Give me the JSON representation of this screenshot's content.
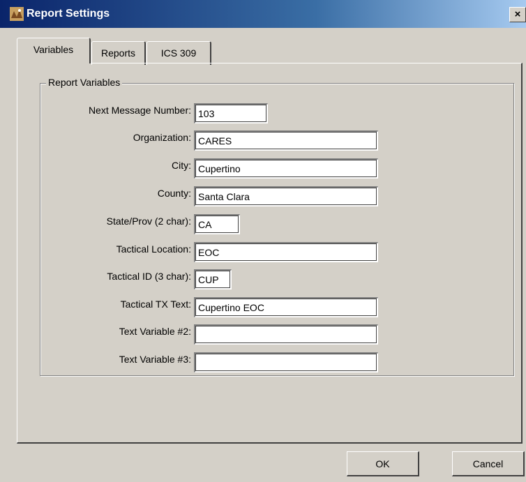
{
  "window": {
    "title": "Report Settings",
    "close_symbol": "×",
    "icon": "app-icon"
  },
  "tabs": [
    {
      "label": "Variables",
      "active": true
    },
    {
      "label": "Reports",
      "active": false
    },
    {
      "label": "ICS 309",
      "active": false
    }
  ],
  "group": {
    "legend": "Report Variables"
  },
  "fields": [
    {
      "label": "Next Message Number:",
      "value": "103"
    },
    {
      "label": "Organization:",
      "value": "CARES"
    },
    {
      "label": "City:",
      "value": "Cupertino"
    },
    {
      "label": "County:",
      "value": "Santa Clara"
    },
    {
      "label": "State/Prov (2 char):",
      "value": "CA"
    },
    {
      "label": "Tactical Location:",
      "value": "EOC"
    },
    {
      "label": "Tactical ID (3 char):",
      "value": "CUP"
    },
    {
      "label": "Tactical TX Text:",
      "value": "Cupertino EOC"
    },
    {
      "label": "Text Variable #2:",
      "value": ""
    },
    {
      "label": "Text Variable #3:",
      "value": ""
    }
  ],
  "buttons": {
    "ok": "OK",
    "cancel": "Cancel"
  },
  "colors": {
    "face": "#d4d0c8",
    "titlebar_start": "#0a246a",
    "titlebar_end": "#a6caf0"
  }
}
